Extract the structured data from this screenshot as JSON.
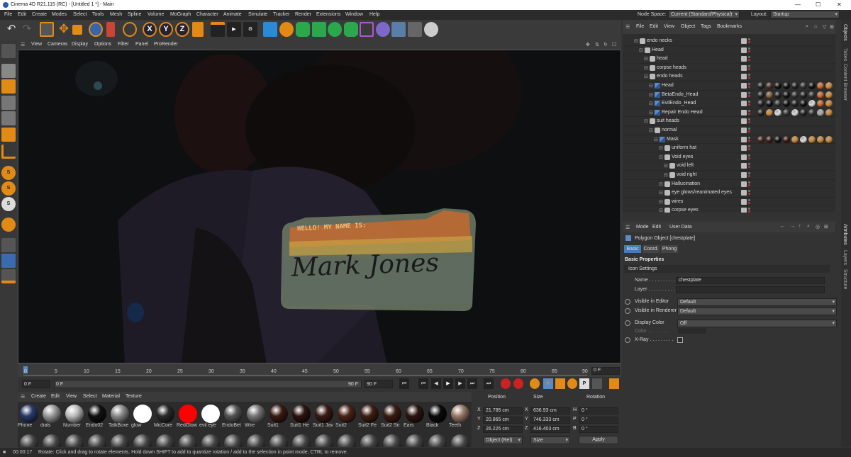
{
  "window": {
    "title": "Cinema 4D R21.115 (RC) - [Untitled 1 *] - Main"
  },
  "menu": [
    "File",
    "Edit",
    "Create",
    "Modes",
    "Select",
    "Tools",
    "Mesh",
    "Spline",
    "Volume",
    "MoGraph",
    "Character",
    "Animate",
    "Simulate",
    "Tracker",
    "Render",
    "Extensions",
    "Window",
    "Help"
  ],
  "nodespace": {
    "label": "Node Space:",
    "value": "Current (Standard/Physical)",
    "layout_label": "Layout:",
    "layout_value": "Startup"
  },
  "viewport_menu": [
    "View",
    "Cameras",
    "Display",
    "Options",
    "Filter",
    "Panel",
    "ProRender"
  ],
  "nametag": {
    "header": "HELLO! MY NAME IS:",
    "name": "Mark Jones"
  },
  "timeline": {
    "ticks": [
      "0",
      "5",
      "10",
      "15",
      "20",
      "25",
      "30",
      "35",
      "40",
      "45",
      "50",
      "55",
      "60",
      "65",
      "70",
      "75",
      "80",
      "85",
      "90"
    ],
    "current": "0 F"
  },
  "playback": {
    "start": "0 F",
    "field2": "0 F",
    "end": "90 F",
    "end2": "90 F"
  },
  "materials": {
    "menu": [
      "Create",
      "Edit",
      "View",
      "Select",
      "Material",
      "Texture"
    ],
    "items": [
      {
        "label": "Phone",
        "color": "#2a3a6a"
      },
      {
        "label": "dials",
        "color": "#9a9a9a"
      },
      {
        "label": "Number",
        "color": "#bdbdbd"
      },
      {
        "label": "Endo02",
        "color": "#111111"
      },
      {
        "label": "TalkBoxe",
        "color": "#8a8a8a"
      },
      {
        "label": "glow",
        "color": "#ffffff"
      },
      {
        "label": "MicCore",
        "color": "#2a2a2a"
      },
      {
        "label": "RedGlow",
        "color": "#ff0000"
      },
      {
        "label": "evil eye",
        "color": "#ffffff"
      },
      {
        "label": "EndoBet",
        "color": "#555555"
      },
      {
        "label": "Wire",
        "color": "#777777"
      },
      {
        "label": "Suit1",
        "color": "#3a1a12"
      },
      {
        "label": "Suit1 He",
        "color": "#2c1410"
      },
      {
        "label": "Suit1 Jav",
        "color": "#3a1a14"
      },
      {
        "label": "Suit2",
        "color": "#4a2418"
      },
      {
        "label": "Suit2 Fe",
        "color": "#3e1e14"
      },
      {
        "label": "Suit2 Sn",
        "color": "#3a1c12"
      },
      {
        "label": "Ears",
        "color": "#2c1610"
      },
      {
        "label": "Black",
        "color": "#0a0a0a"
      },
      {
        "label": "Teeth",
        "color": "#9a7a6a"
      }
    ]
  },
  "coords": {
    "headers": [
      "Position",
      "Size",
      "Rotation"
    ],
    "rows": [
      {
        "axis": "X",
        "pos": "21.785 cm",
        "sz_axis": "X",
        "size": "636.93 cm",
        "rot_axis": "H",
        "rot": "0 °"
      },
      {
        "axis": "Y",
        "pos": "20.865 cm",
        "sz_axis": "Y",
        "size": "746.333 cm",
        "rot_axis": "P",
        "rot": "0 °"
      },
      {
        "axis": "Z",
        "pos": "26.225 cm",
        "sz_axis": "Z",
        "size": "416.403 cm",
        "rot_axis": "B",
        "rot": "0 °"
      }
    ],
    "mode": "Object (Rel)",
    "size_mode": "Size",
    "apply": "Apply"
  },
  "objects": {
    "menu": [
      "File",
      "Edit",
      "View",
      "Object",
      "Tags",
      "Bookmarks"
    ],
    "rows": [
      {
        "name": "endo necks",
        "indent": 0,
        "tags": []
      },
      {
        "name": "Head",
        "indent": 1,
        "tags": []
      },
      {
        "name": "head",
        "indent": 2,
        "tags": []
      },
      {
        "name": "corpse heads",
        "indent": 2,
        "tags": []
      },
      {
        "name": "endo heads",
        "indent": 2,
        "tags": []
      },
      {
        "name": "Head",
        "indent": 3,
        "tags": [
          "#222",
          "#4a3020",
          "#111",
          "#111",
          "#222",
          "#333",
          "#111",
          "#cc6622",
          "#cc8833"
        ]
      },
      {
        "name": "BetaEndo_Head",
        "indent": 3,
        "tags": [
          "#222",
          "#8a6040",
          "#222",
          "#111",
          "#333",
          "#222",
          "#333",
          "#cc6622",
          "#cc8833"
        ]
      },
      {
        "name": "EvilEndo_Head",
        "indent": 3,
        "tags": [
          "#222",
          "#111",
          "#333",
          "#111",
          "#222",
          "#111",
          "#ddd",
          "#cc6622",
          "#cc8833"
        ]
      },
      {
        "name": "Repair Endo Head",
        "indent": 3,
        "tags": [
          "#222",
          "#cc8833",
          "#ddd",
          "#333",
          "#ddd",
          "#222",
          "#333",
          "#aaa",
          "#cc8833"
        ]
      },
      {
        "name": "suit heads",
        "indent": 2,
        "tags": []
      },
      {
        "name": "normal",
        "indent": 3,
        "tags": []
      },
      {
        "name": "Mask",
        "indent": 4,
        "tags": [
          "#4a2418",
          "#3a1c12",
          "#111",
          "#3a1a12",
          "#cc8833",
          "#ddd",
          "#cc8833",
          "#cc8833",
          "#cc8833"
        ]
      },
      {
        "name": "uniform hat",
        "indent": 5,
        "tags": []
      },
      {
        "name": "Void eyes",
        "indent": 5,
        "tags": []
      },
      {
        "name": "void left",
        "indent": 6,
        "tags": []
      },
      {
        "name": "void right",
        "indent": 6,
        "tags": []
      },
      {
        "name": "Hallucination",
        "indent": 5,
        "tags": []
      },
      {
        "name": "eye glows/reanimated eyes",
        "indent": 5,
        "tags": []
      },
      {
        "name": "wires",
        "indent": 5,
        "tags": []
      },
      {
        "name": "corpse eyes",
        "indent": 5,
        "tags": []
      }
    ]
  },
  "attributes": {
    "menu": [
      "Mode",
      "Edit",
      "User Data"
    ],
    "object_title": "Polygon Object [chestplate]",
    "tabs": [
      "Basic",
      "Coord.",
      "Phong"
    ],
    "section": "Basic Properties",
    "icon_settings": "Icon Settings",
    "fields": [
      {
        "label": "Name . . . . . . . . . .",
        "value": "chestplate"
      },
      {
        "label": "Layer . . . . . . . . . .",
        "value": ""
      }
    ],
    "visible_editor_label": "Visible in Editor",
    "visible_editor": "Default",
    "visible_renderer_label": "Visible in Renderer",
    "visible_renderer": "Default",
    "display_color_label": "Display Color",
    "display_color": "Off",
    "color_label": "Color . . . . . . . .",
    "xray_label": "X-Ray . . . . . . . . ."
  },
  "right_tabs": [
    "Objects",
    "Takes",
    "Content Browser",
    "Attributes",
    "Layers",
    "Structure"
  ],
  "status": {
    "time": "00:00:17",
    "message": "Rotate: Click and drag to rotate elements. Hold down SHIFT to add to quantize rotation / add to the selection in point mode, CTRL to remove."
  }
}
